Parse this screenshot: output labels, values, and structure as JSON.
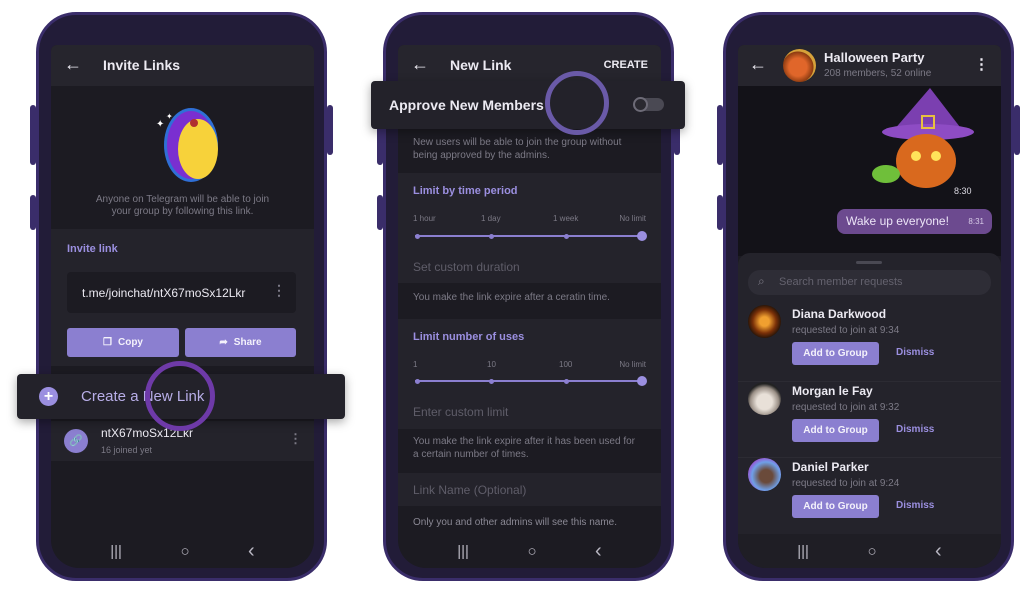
{
  "colors": {
    "accent": "#8b7fd0",
    "screen_bg": "#1c1b22",
    "frame": "#221c38",
    "bubble": "#6c4a8f"
  },
  "invite_links": {
    "title": "Invite Links",
    "description_line1": "Anyone on Telegram will be able to join",
    "description_line2": "your group by following this link.",
    "section_label": "Invite link",
    "link": "t.me/joinchat/ntX67moSx12Lkr",
    "copy_label": "Copy",
    "share_label": "Share",
    "create_label": "Create a New Link",
    "existing_link": {
      "name": "ntX67moSx12Lkr",
      "joined": "16 joined yet"
    }
  },
  "new_link": {
    "title": "New Link",
    "create_label": "CREATE",
    "approve_label": "Approve New Members",
    "approve_enabled": false,
    "approve_desc_line1": "New users will be able to join the group without",
    "approve_desc_line2": "being approved by the admins.",
    "time_label": "Limit by time period",
    "time_ticks": [
      "1 hour",
      "1 day",
      "1 week",
      "No limit"
    ],
    "time_selected": "No limit",
    "time_custom_placeholder": "Set custom duration",
    "time_hint": "You make the link expire after a ceratin time.",
    "uses_label": "Limit number of uses",
    "uses_ticks": [
      "1",
      "10",
      "100",
      "No limit"
    ],
    "uses_selected": "No limit",
    "uses_custom_placeholder": "Enter custom limit",
    "uses_hint_line1": "You make the link expire after it has been used for",
    "uses_hint_line2": "a certain number of times.",
    "name_placeholder": "Link Name (Optional)",
    "name_hint": "Only you and other admins will see this name."
  },
  "chat": {
    "title": "Halloween Party",
    "subtitle": "208 members, 52 online",
    "sticker_time": "8:30",
    "message": {
      "text": "Wake up everyone!",
      "time": "8:31"
    },
    "search_placeholder": "Search member requests",
    "add_label": "Add to Group",
    "dismiss_label": "Dismiss",
    "requests": [
      {
        "name": "Diana Darkwood",
        "sub": "requested to join at 9:34"
      },
      {
        "name": "Morgan le Fay",
        "sub": "requested to join at 9:32"
      },
      {
        "name": "Daniel Parker",
        "sub": "requested to join at 9:24"
      }
    ]
  },
  "nav": {
    "recents": "|||",
    "home": "○",
    "back": "‹"
  }
}
